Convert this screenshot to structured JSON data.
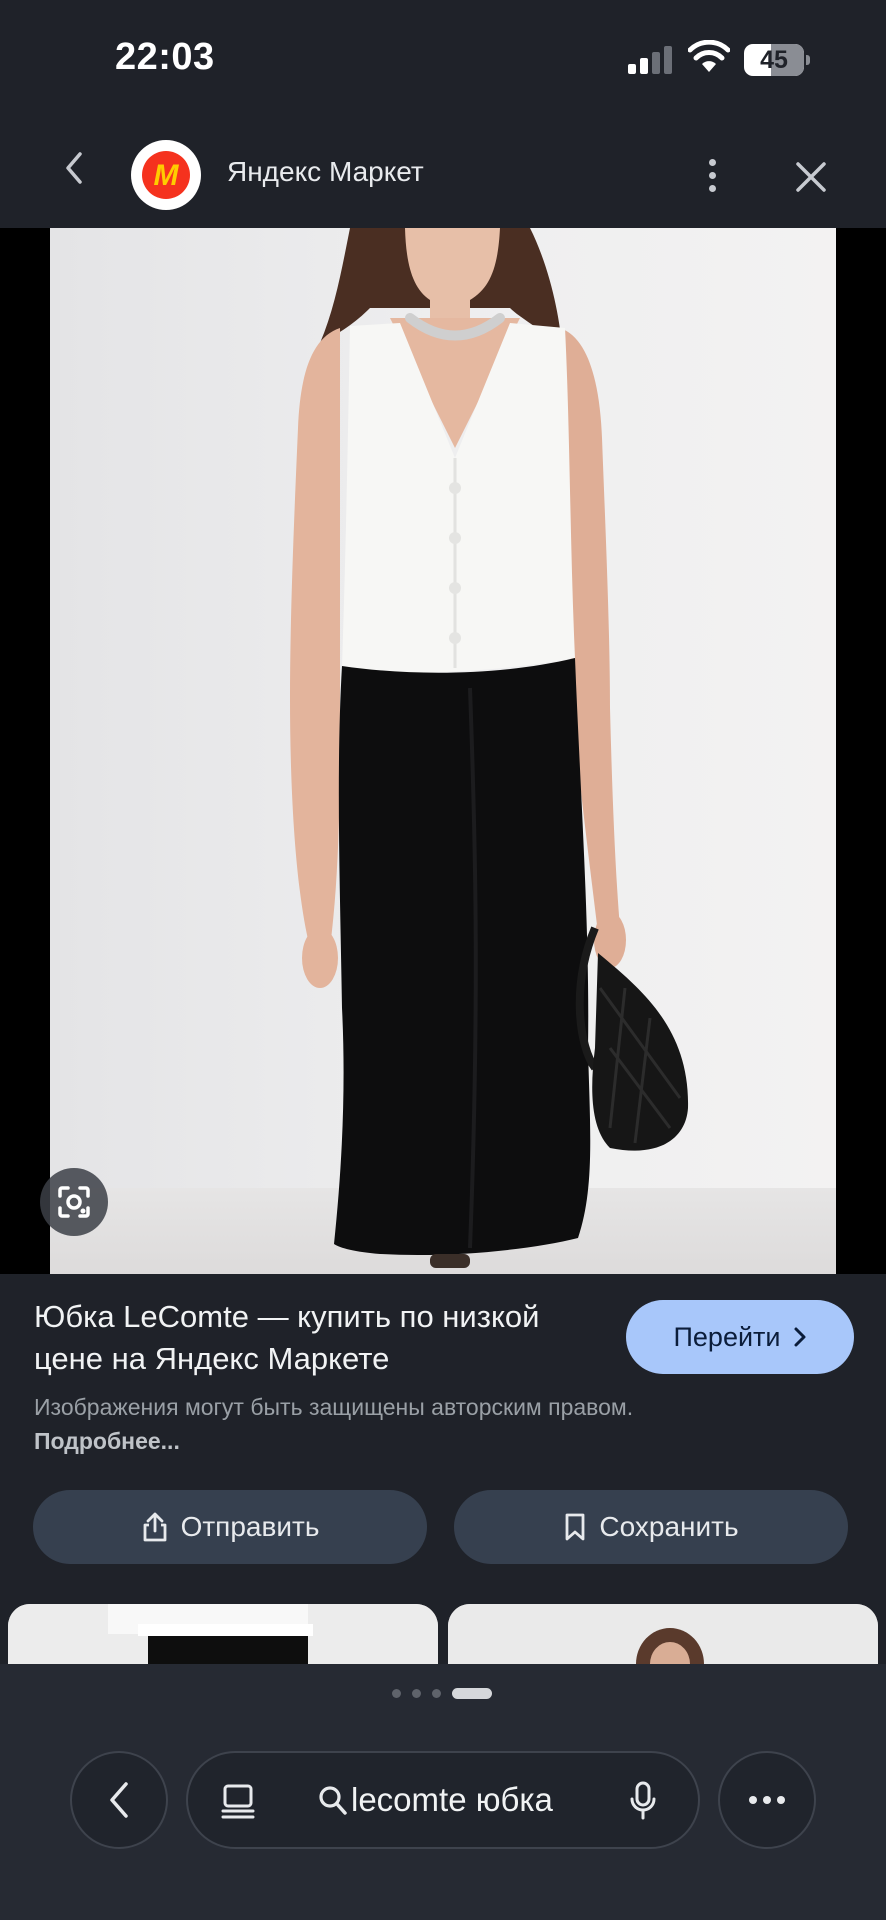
{
  "status": {
    "time": "22:03",
    "battery_level": "45",
    "battery_fraction": 0.45
  },
  "header": {
    "site_name": "Яндекс Маркет",
    "logo_letter": "M"
  },
  "result": {
    "title": "Юбка LeComte — купить по низкой цене на Яндекс Маркете",
    "go_button": "Перейти",
    "notice_text": "Изображения могут быть защищены авторским правом.",
    "notice_link": "Подробнее..."
  },
  "actions": {
    "share_label": "Отправить",
    "save_label": "Сохранить"
  },
  "bottom_bar": {
    "search_query": "lecomte юбка",
    "pages_total": 4,
    "active_page": 4
  },
  "colors": {
    "background": "#1f2229",
    "accent_button": "#a8c7fa",
    "action_button": "#36404f",
    "logo_red": "#f5321e",
    "logo_yellow": "#ffcc00"
  },
  "icons": [
    "back-chevron-icon",
    "yandex-market-logo",
    "more-vertical-icon",
    "close-icon",
    "lens-icon",
    "chevron-right-icon",
    "share-icon",
    "bookmark-icon",
    "tabs-icon",
    "search-icon",
    "mic-icon",
    "more-horizontal-icon"
  ]
}
